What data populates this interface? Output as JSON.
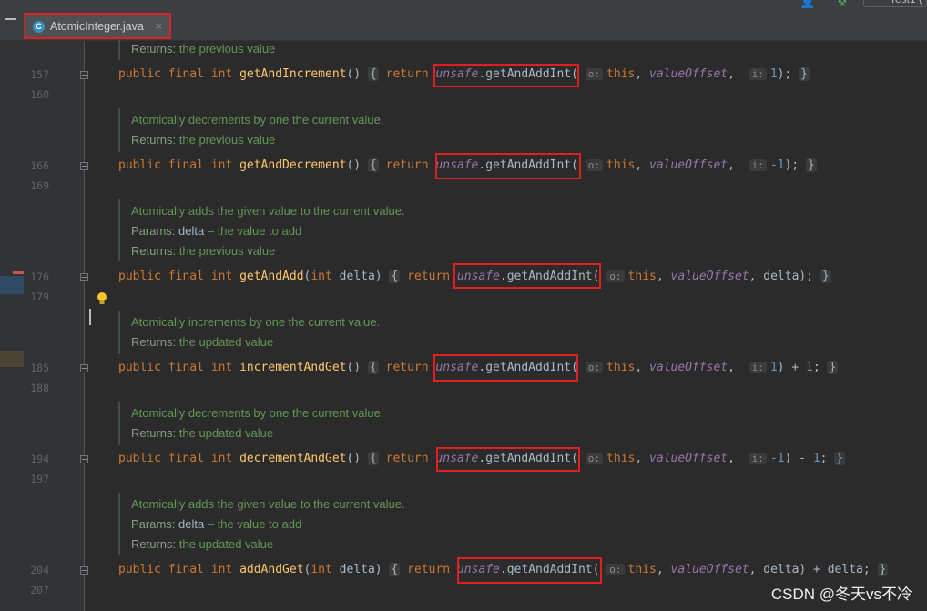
{
  "tab": {
    "icon_glyph": "C",
    "label": "AtomicInteger.java",
    "close": "×"
  },
  "topright": {
    "run_config": "Test1 ("
  },
  "line_numbers": [
    "157",
    "160",
    "166",
    "169",
    "176",
    "179",
    "185",
    "188",
    "194",
    "197",
    "204",
    "207"
  ],
  "keywords": {
    "public": "public",
    "final": "final",
    "int": "int",
    "return": "return",
    "this": "this"
  },
  "ident": {
    "unsafe": "unsafe",
    "method": ".getAndAddInt",
    "valueOffset": "valueOffset",
    "delta": "delta"
  },
  "hints": {
    "o": "o:",
    "i": "i:"
  },
  "docs": {
    "returns_label": "Returns:",
    "params_label": "Params:",
    "delta_param": "delta",
    "delta_desc": " – the value to add",
    "previous": "the previous value",
    "updated": "the updated value",
    "inc": "Atomically increments by one the current value.",
    "dec": "Atomically decrements by one the current value.",
    "add": "Atomically adds the given value to the current value."
  },
  "methods": {
    "m1": {
      "name": "getAndIncrement",
      "params": "()",
      "arg": "1",
      "tail": ");"
    },
    "m2": {
      "name": "getAndDecrement",
      "params": "()",
      "arg": "-1",
      "tail": ");"
    },
    "m3": {
      "name": "getAndAdd",
      "params_pre": "(",
      "params_post": " delta)",
      "tail": ");"
    },
    "m4": {
      "name": "incrementAndGet",
      "params": "()",
      "arg": "1",
      "tail": ") + ",
      "num": "1",
      "end": ";"
    },
    "m5": {
      "name": "decrementAndGet",
      "params": "()",
      "arg": "-1",
      "tail": ") - ",
      "num": "1",
      "end": ";"
    },
    "m6": {
      "name": "addAndGet",
      "params_pre": "(",
      "params_post": " delta)",
      "tail": ") + delta",
      "end": ";"
    }
  },
  "watermark": "CSDN @冬天vs不冷",
  "colors": {
    "highlight_box": "#e02020",
    "keyword": "#cc7832",
    "field": "#9876aa",
    "doc": "#629755"
  }
}
